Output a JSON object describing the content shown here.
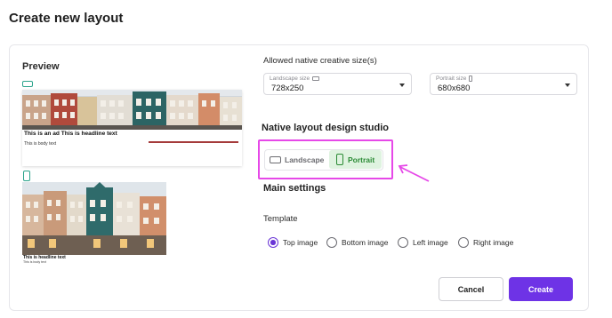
{
  "page": {
    "title": "Create new layout"
  },
  "preview": {
    "label": "Preview",
    "landscape_ad": {
      "headline": "This is an ad This is headline text",
      "body": "This is body text"
    },
    "portrait_ad": {
      "headline": "This is headline text",
      "body": "This is body text"
    }
  },
  "sizes": {
    "section_label": "Allowed native creative size(s)",
    "landscape": {
      "caption": "Landscape size",
      "value": "728x250"
    },
    "portrait": {
      "caption": "Portrait size",
      "value": "680x680"
    }
  },
  "studio": {
    "title": "Native layout design studio",
    "options": [
      {
        "label": "Landscape",
        "selected": false
      },
      {
        "label": "Portrait",
        "selected": true
      }
    ],
    "highlight_color": "#e648e8"
  },
  "main_settings": {
    "title": "Main settings",
    "template_label": "Template",
    "template_options": [
      {
        "label": "Top image",
        "selected": true
      },
      {
        "label": "Bottom image",
        "selected": false
      },
      {
        "label": "Left image",
        "selected": false
      },
      {
        "label": "Right image",
        "selected": false
      }
    ]
  },
  "actions": {
    "cancel_label": "Cancel",
    "create_label": "Create"
  },
  "colors": {
    "accent": "#6e33e6",
    "portrait_selected_bg": "#dff3e0",
    "portrait_selected_fg": "#2a8a34",
    "preview_chip": "#2aa38b"
  }
}
